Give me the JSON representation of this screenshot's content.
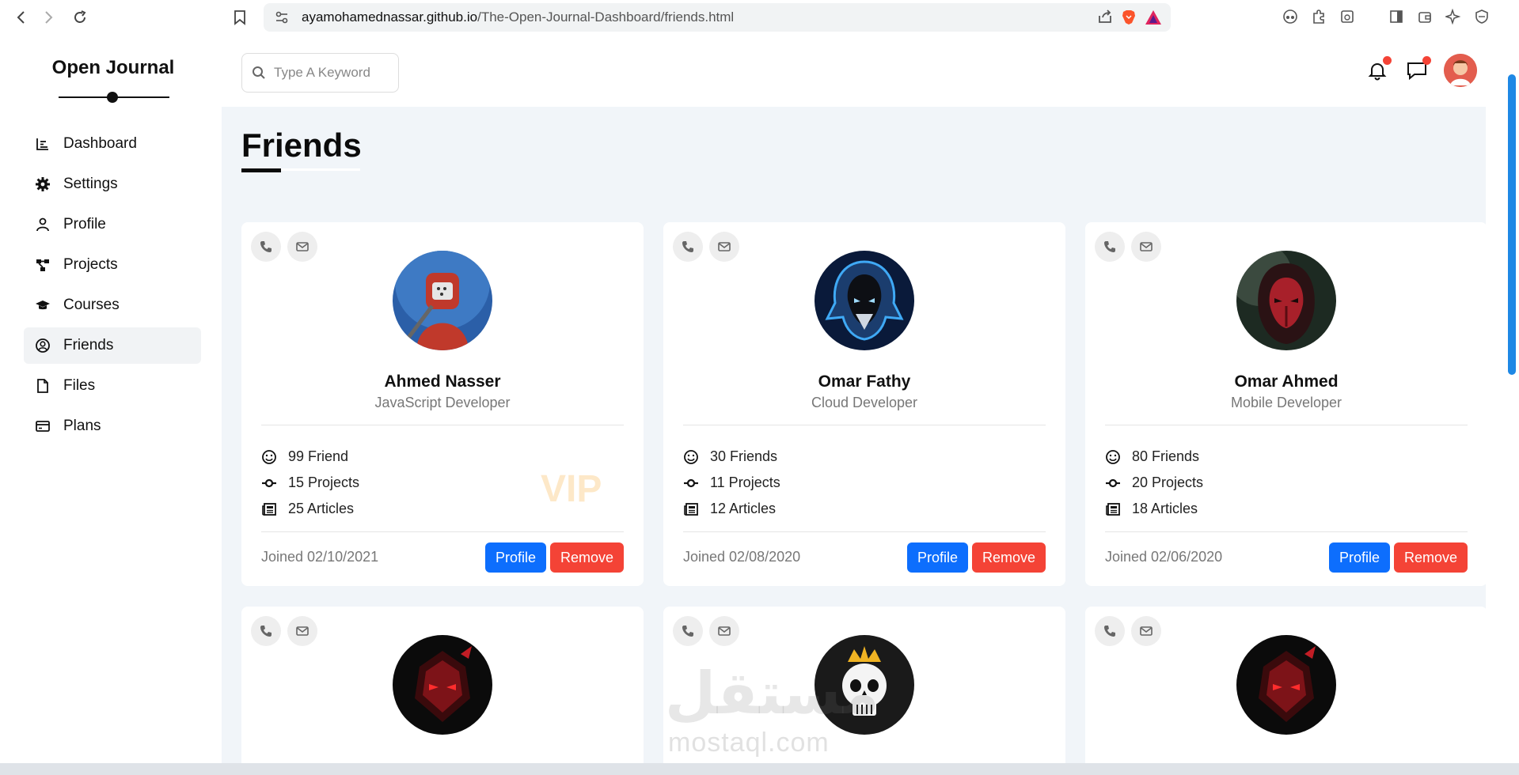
{
  "browser": {
    "url_host": "ayamohamednassar.github.io",
    "url_path": "/The-Open-Journal-Dashboard/friends.html"
  },
  "sidebar": {
    "brand": "Open Journal",
    "items": [
      {
        "label": "Dashboard",
        "icon": "chart-icon",
        "active": false
      },
      {
        "label": "Settings",
        "icon": "gear-icon",
        "active": false
      },
      {
        "label": "Profile",
        "icon": "user-icon",
        "active": false
      },
      {
        "label": "Projects",
        "icon": "diagram-icon",
        "active": false
      },
      {
        "label": "Courses",
        "icon": "graduation-cap-icon",
        "active": false
      },
      {
        "label": "Friends",
        "icon": "user-circle-icon",
        "active": true
      },
      {
        "label": "Files",
        "icon": "file-icon",
        "active": false
      },
      {
        "label": "Plans",
        "icon": "credit-card-icon",
        "active": false
      }
    ]
  },
  "topbar": {
    "search_placeholder": "Type A Keyword"
  },
  "page": {
    "title": "Friends"
  },
  "friends": [
    {
      "name": "Ahmed Nasser",
      "role": "JavaScript Developer",
      "friends": "99 Friend",
      "projects": "15 Projects",
      "articles": "25 Articles",
      "badge": "VIP",
      "joined": "Joined 02/10/2021",
      "profile_label": "Profile",
      "remove_label": "Remove",
      "avatar_colors": [
        "#2b5fa8",
        "#c0392b"
      ]
    },
    {
      "name": "Omar Fathy",
      "role": "Cloud Developer",
      "friends": "30 Friends",
      "projects": "11 Projects",
      "articles": "12 Articles",
      "badge": "",
      "joined": "Joined 02/08/2020",
      "profile_label": "Profile",
      "remove_label": "Remove",
      "avatar_colors": [
        "#0a1a3a",
        "#3fa9f5"
      ]
    },
    {
      "name": "Omar Ahmed",
      "role": "Mobile Developer",
      "friends": "80 Friends",
      "projects": "20 Projects",
      "articles": "18 Articles",
      "badge": "",
      "joined": "Joined 02/06/2020",
      "profile_label": "Profile",
      "remove_label": "Remove",
      "avatar_colors": [
        "#1d2a22",
        "#a8202a"
      ]
    }
  ],
  "watermark": {
    "arabic": "مستقل",
    "latin": "mostaql.com"
  }
}
